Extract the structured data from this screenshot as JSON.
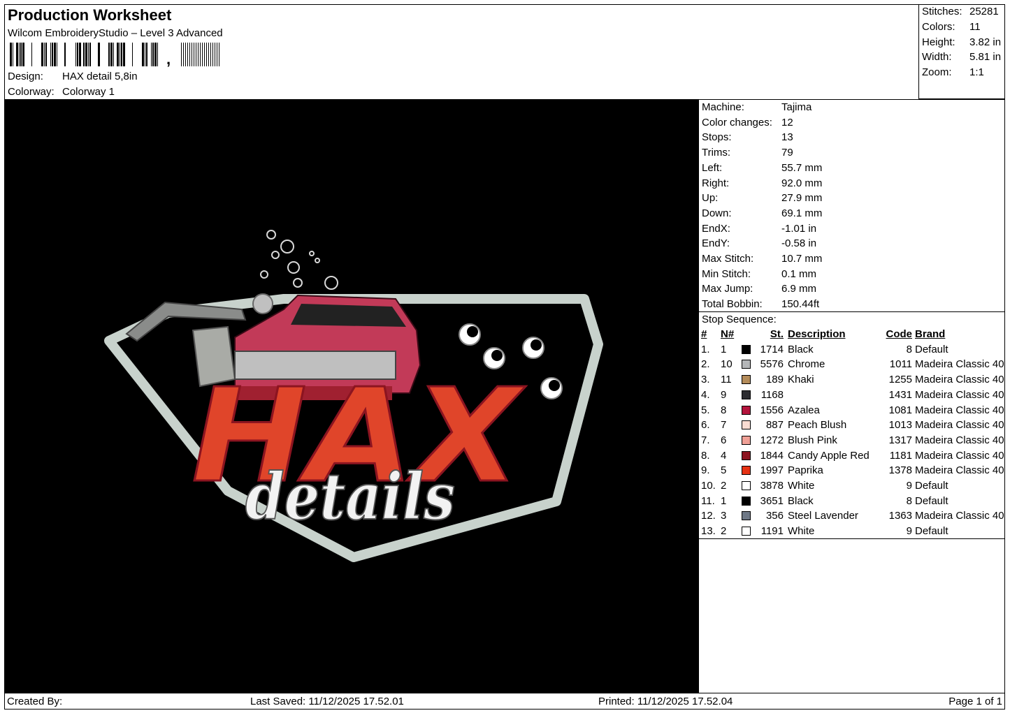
{
  "header": {
    "title": "Production Worksheet",
    "software": "Wilcom EmbroideryStudio – Level 3 Advanced",
    "barcode_suffix": ",",
    "design_label": "Design:",
    "design_value": "HAX detail 5,8in",
    "colorway_label": "Colorway:",
    "colorway_value": "Colorway 1"
  },
  "stats": [
    {
      "label": "Stitches:",
      "value": "25281"
    },
    {
      "label": "Colors:",
      "value": "11"
    },
    {
      "label": "Height:",
      "value": "3.82 in"
    },
    {
      "label": "Width:",
      "value": "5.81 in"
    },
    {
      "label": "Zoom:",
      "value": "1:1"
    }
  ],
  "machine_info": [
    {
      "label": "Machine:",
      "value": "Tajima"
    },
    {
      "label": "Color changes:",
      "value": "12"
    },
    {
      "label": "Stops:",
      "value": "13"
    },
    {
      "label": "Trims:",
      "value": "79"
    },
    {
      "label": "Left:",
      "value": "55.7 mm"
    },
    {
      "label": "Right:",
      "value": "92.0 mm"
    },
    {
      "label": "Up:",
      "value": "27.9 mm"
    },
    {
      "label": "Down:",
      "value": "69.1 mm"
    },
    {
      "label": "EndX:",
      "value": "-1.01 in"
    },
    {
      "label": "EndY:",
      "value": "-0.58 in"
    },
    {
      "label": "Max Stitch:",
      "value": "10.7 mm"
    },
    {
      "label": "Min Stitch:",
      "value": "0.1 mm"
    },
    {
      "label": "Max Jump:",
      "value": "6.9 mm"
    },
    {
      "label": "Total Bobbin:",
      "value": "150.44ft"
    }
  ],
  "stop_sequence": {
    "title": "Stop Sequence:",
    "columns": {
      "num": "#",
      "n": "N#",
      "st": "St.",
      "desc": "Description",
      "code": "Code",
      "brand": "Brand"
    },
    "rows": [
      {
        "num": "1.",
        "n": "1",
        "color": "#000000",
        "st": "1714",
        "desc": "Black",
        "code": "8",
        "brand": "Default"
      },
      {
        "num": "2.",
        "n": "10",
        "color": "#b4b6b8",
        "st": "5576",
        "desc": "Chrome",
        "code": "1011",
        "brand": "Madeira Classic 40"
      },
      {
        "num": "3.",
        "n": "11",
        "color": "#b48c5a",
        "st": "189",
        "desc": "Khaki",
        "code": "1255",
        "brand": "Madeira Classic 40"
      },
      {
        "num": "4.",
        "n": "9",
        "color": "#2c2c30",
        "st": "1168",
        "desc": "",
        "code": "1431",
        "brand": "Madeira Classic 40"
      },
      {
        "num": "5.",
        "n": "8",
        "color": "#b4143c",
        "st": "1556",
        "desc": "Azalea",
        "code": "1081",
        "brand": "Madeira Classic 40"
      },
      {
        "num": "6.",
        "n": "7",
        "color": "#fadcd2",
        "st": "887",
        "desc": "Peach Blush",
        "code": "1013",
        "brand": "Madeira Classic 40"
      },
      {
        "num": "7.",
        "n": "6",
        "color": "#f0a096",
        "st": "1272",
        "desc": "Blush Pink",
        "code": "1317",
        "brand": "Madeira Classic 40"
      },
      {
        "num": "8.",
        "n": "4",
        "color": "#8c1420",
        "st": "1844",
        "desc": "Candy Apple Red",
        "code": "1181",
        "brand": "Madeira Classic 40"
      },
      {
        "num": "9.",
        "n": "5",
        "color": "#e63214",
        "st": "1997",
        "desc": "Paprika",
        "code": "1378",
        "brand": "Madeira Classic 40"
      },
      {
        "num": "10.",
        "n": "2",
        "color": "#ffffff",
        "st": "3878",
        "desc": "White",
        "code": "9",
        "brand": "Default"
      },
      {
        "num": "11.",
        "n": "1",
        "color": "#000000",
        "st": "3651",
        "desc": "Black",
        "code": "8",
        "brand": "Default"
      },
      {
        "num": "12.",
        "n": "3",
        "color": "#6e7886",
        "st": "356",
        "desc": "Steel Lavender",
        "code": "1363",
        "brand": "Madeira Classic 40"
      },
      {
        "num": "13.",
        "n": "2",
        "color": "#ffffff",
        "st": "1191",
        "desc": "White",
        "code": "9",
        "brand": "Default"
      }
    ]
  },
  "design_art": {
    "line1": "HAX",
    "line2": "details"
  },
  "footer": {
    "created_by": "Created By:",
    "last_saved": "Last Saved: 11/12/2025 17.52.01",
    "printed": "Printed: 11/12/2025 17.52.04",
    "page": "Page 1 of 1"
  }
}
